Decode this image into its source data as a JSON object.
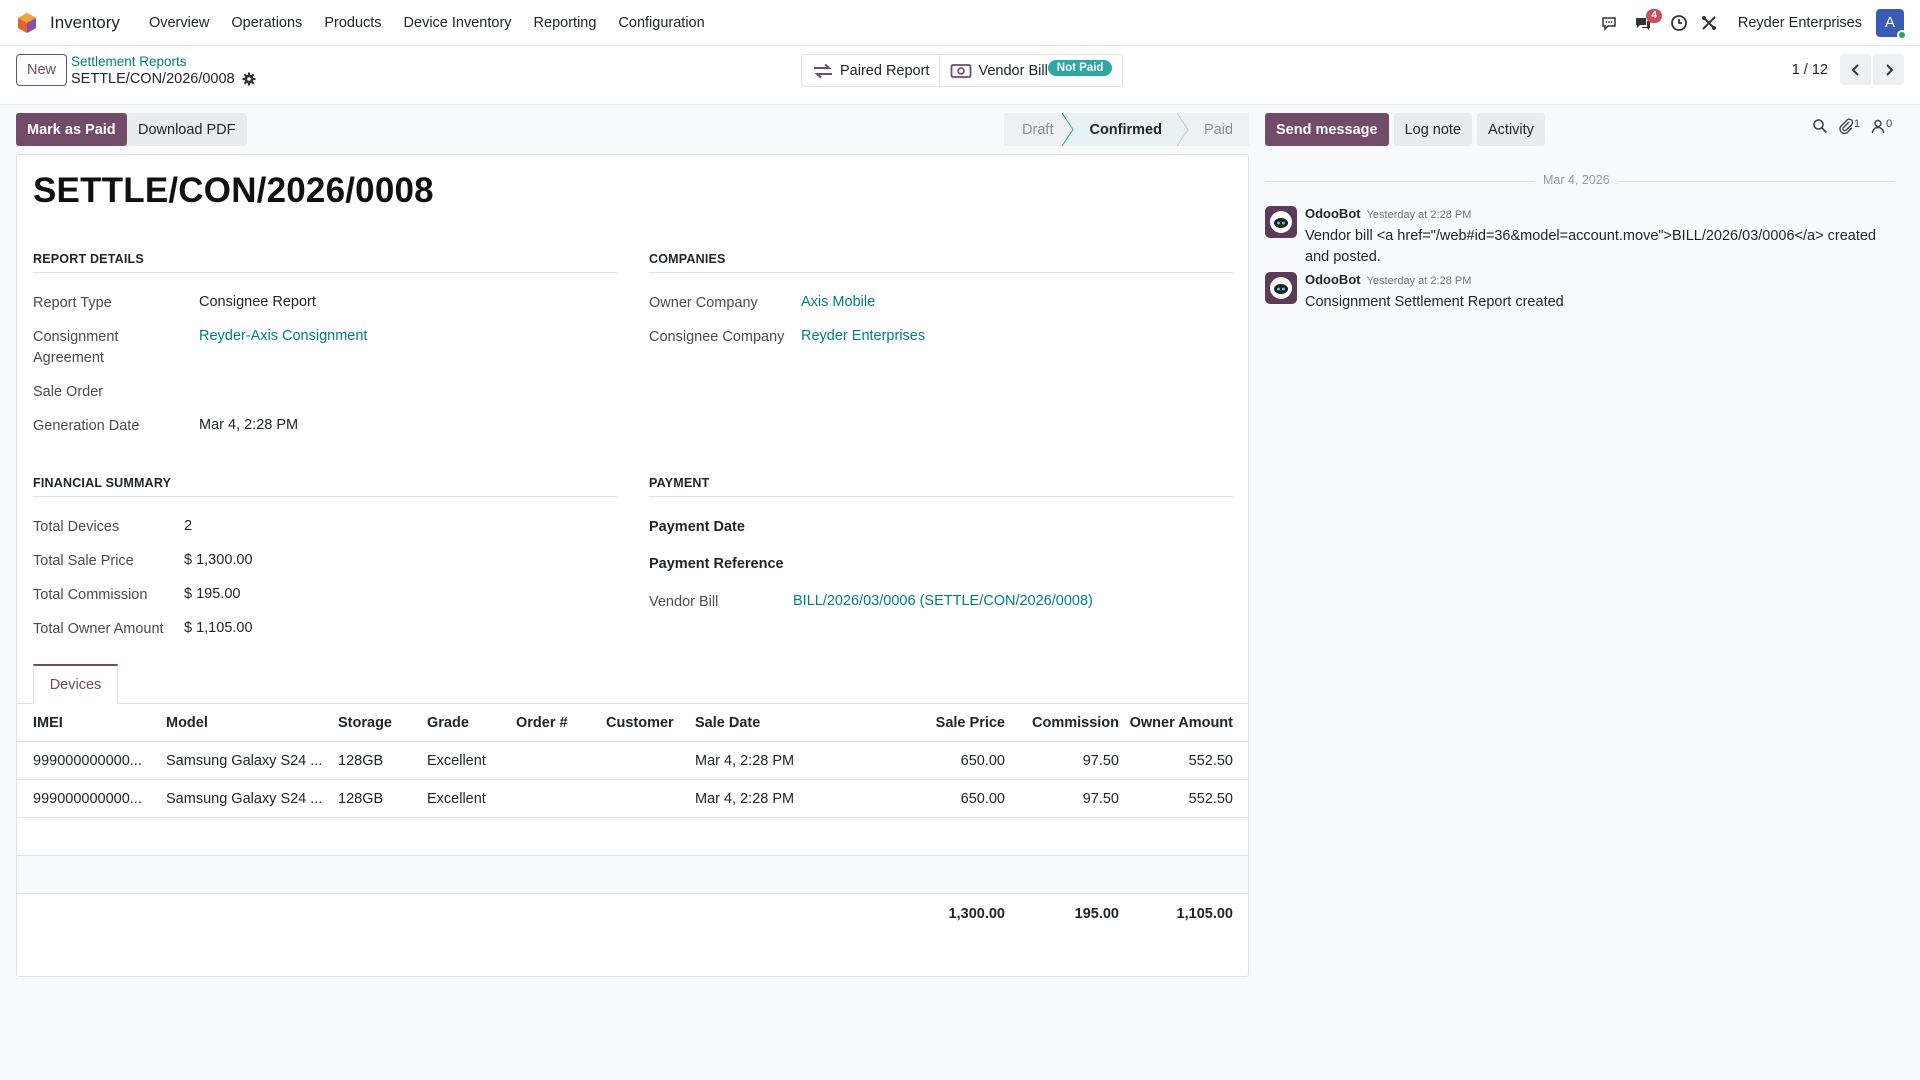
{
  "navbar": {
    "app_name": "Inventory",
    "menu": [
      "Overview",
      "Operations",
      "Products",
      "Device Inventory",
      "Reporting",
      "Configuration"
    ],
    "messages_badge": "4",
    "company": "Reyder Enterprises",
    "avatar_initial": "A"
  },
  "control_panel": {
    "new_label": "New",
    "breadcrumb_parent": "Settlement Reports",
    "breadcrumb_current": "SETTLE/CON/2026/0008",
    "smart_buttons": {
      "paired_report": "Paired Report",
      "vendor_bill": "Vendor Bill",
      "vendor_bill_badge": "Not Paid"
    },
    "pager": "1 / 12"
  },
  "statusbar": {
    "mark_paid": "Mark as Paid",
    "download_pdf": "Download PDF",
    "stages": [
      "Draft",
      "Confirmed",
      "Paid"
    ],
    "active_stage": "Confirmed"
  },
  "form": {
    "title": "SETTLE/CON/2026/0008",
    "report_details": {
      "heading": "REPORT DETAILS",
      "report_type_label": "Report Type",
      "report_type": "Consignee Report",
      "agreement_label_1": "Consignment",
      "agreement_label_2": "Agreement",
      "agreement": "Reyder-Axis Consignment",
      "sale_order_label": "Sale Order",
      "sale_order": "",
      "generation_date_label": "Generation Date",
      "generation_date": "Mar 4, 2:28 PM"
    },
    "companies": {
      "heading": "COMPANIES",
      "owner_label": "Owner Company",
      "owner": "Axis Mobile",
      "consignee_label": "Consignee Company",
      "consignee": "Reyder Enterprises"
    },
    "financial_summary": {
      "heading": "FINANCIAL SUMMARY",
      "total_devices_label": "Total Devices",
      "total_devices": "2",
      "total_sale_label": "Total Sale Price",
      "total_sale": "$ 1,300.00",
      "total_commission_label": "Total Commission",
      "total_commission": "$ 195.00",
      "total_owner_label": "Total Owner Amount",
      "total_owner": "$ 1,105.00"
    },
    "payment": {
      "heading": "PAYMENT",
      "payment_date_label": "Payment Date",
      "payment_date": "",
      "payment_ref_label": "Payment Reference",
      "payment_ref": "",
      "vendor_bill_label": "Vendor Bill",
      "vendor_bill": "BILL/2026/03/0006 (SETTLE/CON/2026/0008)"
    },
    "tab_label": "Devices",
    "devices_table": {
      "headers": [
        "IMEI",
        "Model",
        "Storage",
        "Grade",
        "Order #",
        "Customer",
        "Sale Date",
        "Sale Price",
        "Commission",
        "Owner Amount"
      ],
      "rows": [
        [
          "999000000000...",
          "Samsung Galaxy S24 ...",
          "128GB",
          "Excellent",
          "",
          "",
          "Mar 4, 2:28 PM",
          "650.00",
          "97.50",
          "552.50"
        ],
        [
          "999000000000...",
          "Samsung Galaxy S24 ...",
          "128GB",
          "Excellent",
          "",
          "",
          "Mar 4, 2:28 PM",
          "650.00",
          "97.50",
          "552.50"
        ]
      ],
      "totals": {
        "sale_price": "1,300.00",
        "commission": "195.00",
        "owner_amount": "1,105.00"
      }
    }
  },
  "chatter": {
    "send_message": "Send message",
    "log_note": "Log note",
    "activity": "Activity",
    "attachments_count": "1",
    "followers_count": "0",
    "date_separator": "Mar 4, 2026",
    "messages": [
      {
        "author": "OdooBot",
        "time": "Yesterday at 2:28 PM",
        "body": "Vendor bill <a href=\"/web#id=36&model=account.move\">BILL/2026/03/0006</a> created and posted."
      },
      {
        "author": "OdooBot",
        "time": "Yesterday at 2:28 PM",
        "body": "Consignment Settlement Report created"
      }
    ]
  },
  "colors": {
    "primary": "#714b67",
    "link": "#017e84",
    "badge_teal": "#2ba8a4",
    "notification_red": "#d44c59"
  }
}
